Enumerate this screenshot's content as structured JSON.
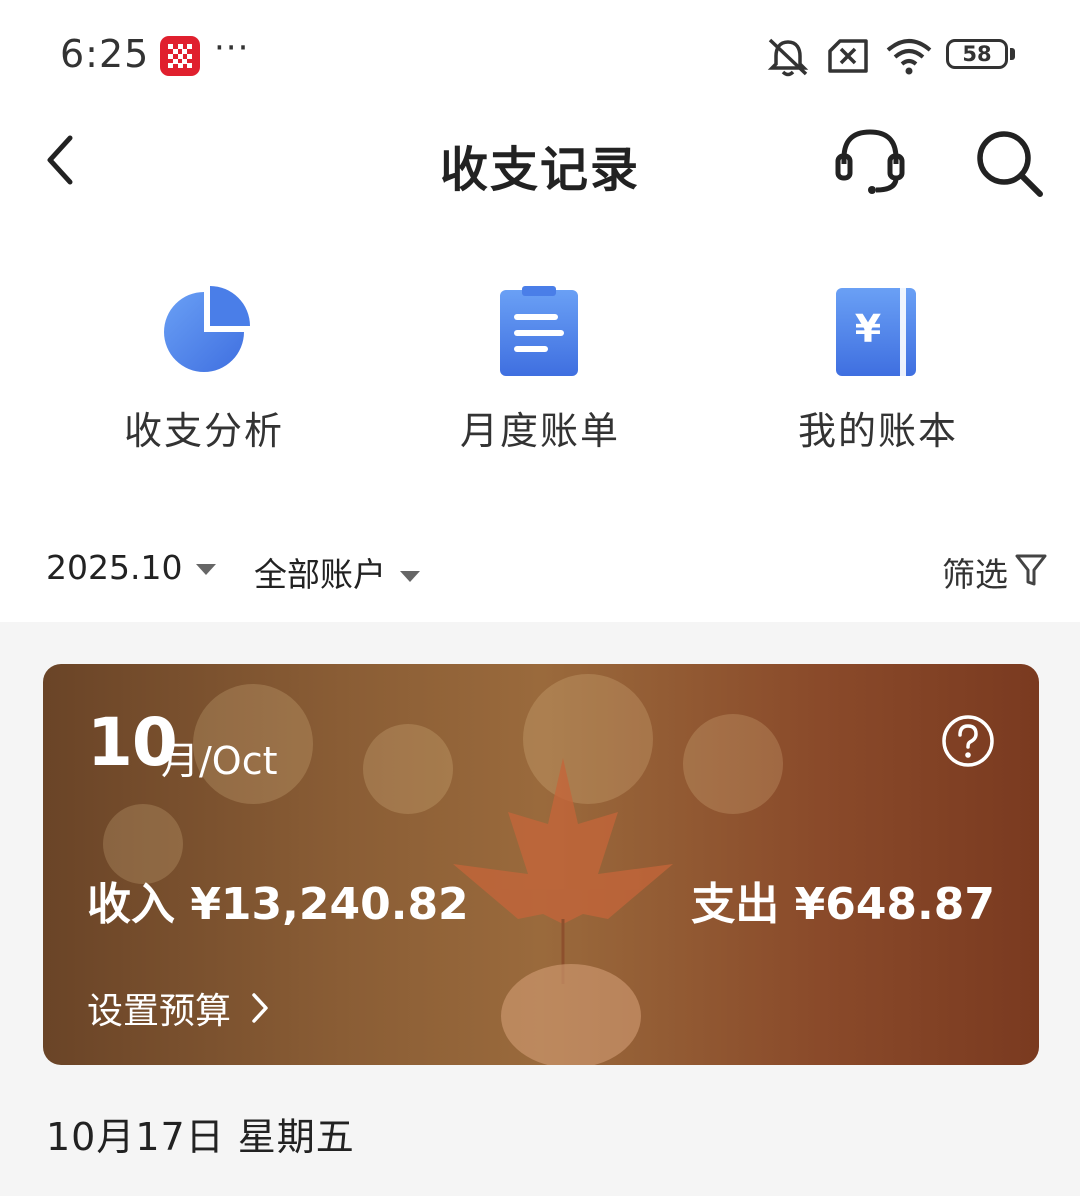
{
  "status_bar": {
    "time": "6:25",
    "more": "···",
    "battery": "58",
    "icons": [
      "app-notification-icon",
      "mute-icon",
      "sim-off-icon",
      "wifi-icon",
      "battery-icon"
    ]
  },
  "header": {
    "title": "收支记录",
    "icons": [
      "back-icon",
      "headset-icon",
      "search-icon"
    ]
  },
  "quick_actions": [
    {
      "label": "收支分析",
      "icon": "pie-chart-icon"
    },
    {
      "label": "月度账单",
      "icon": "clipboard-icon"
    },
    {
      "label": "我的账本",
      "icon": "ledger-icon"
    }
  ],
  "filters": {
    "date": "2025.10",
    "account": "全部账户",
    "filter_label": "筛选"
  },
  "summary": {
    "month_number": "10",
    "month_word": "月/Oct",
    "income": "收入 ¥13,240.82",
    "expense": "支出 ¥648.87",
    "budget_link": "设置预算"
  },
  "list": {
    "date_heading": "10月17日 星期五"
  },
  "colors": {
    "accent_blue": "#4a7ee8",
    "icon_blue_light": "#6aa0f5",
    "banner_brown": "#8a5d35",
    "app_red": "#e0202e"
  }
}
